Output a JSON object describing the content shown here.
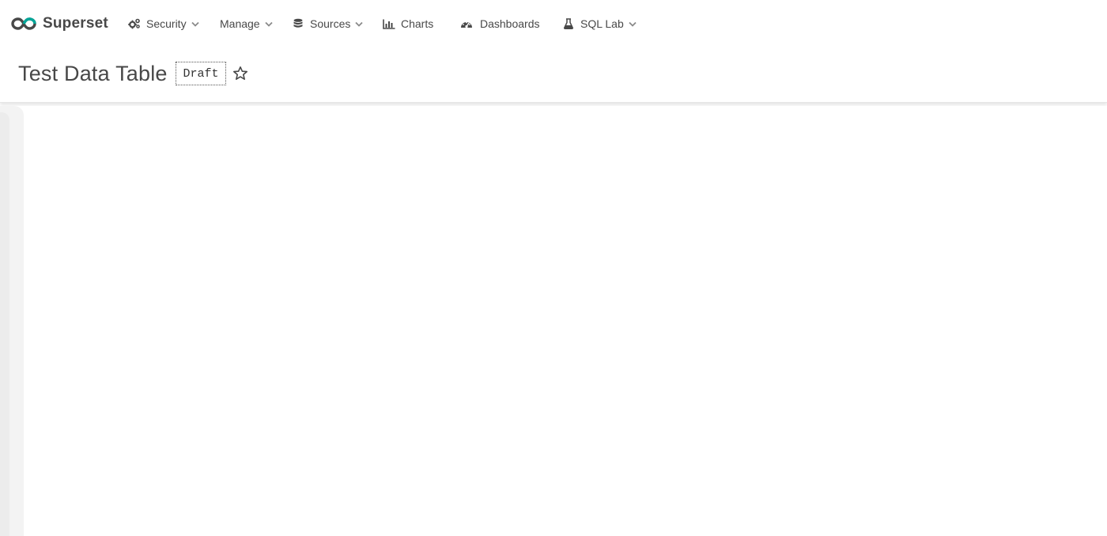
{
  "brand": {
    "name": "Superset",
    "logo_icon": "infinity-logo-icon",
    "accent_color": "#00a699"
  },
  "nav": {
    "items": [
      {
        "label": "Security",
        "icon": "cogs-icon",
        "has_dropdown": true
      },
      {
        "label": "Manage",
        "icon": "",
        "has_dropdown": true
      },
      {
        "label": "Sources",
        "icon": "database-icon",
        "has_dropdown": true
      },
      {
        "label": "Charts",
        "icon": "bar-chart-icon",
        "has_dropdown": false
      },
      {
        "label": "Dashboards",
        "icon": "dashboard-gauge-icon",
        "has_dropdown": false
      },
      {
        "label": "SQL Lab",
        "icon": "flask-icon",
        "has_dropdown": true
      }
    ]
  },
  "header": {
    "title": "Test Data Table",
    "status_badge": "Draft",
    "favorite_icon": "star-outline-icon"
  },
  "colors": {
    "text": "#484848",
    "caret": "#8a8a8a",
    "rail": "#f3f3f3"
  }
}
